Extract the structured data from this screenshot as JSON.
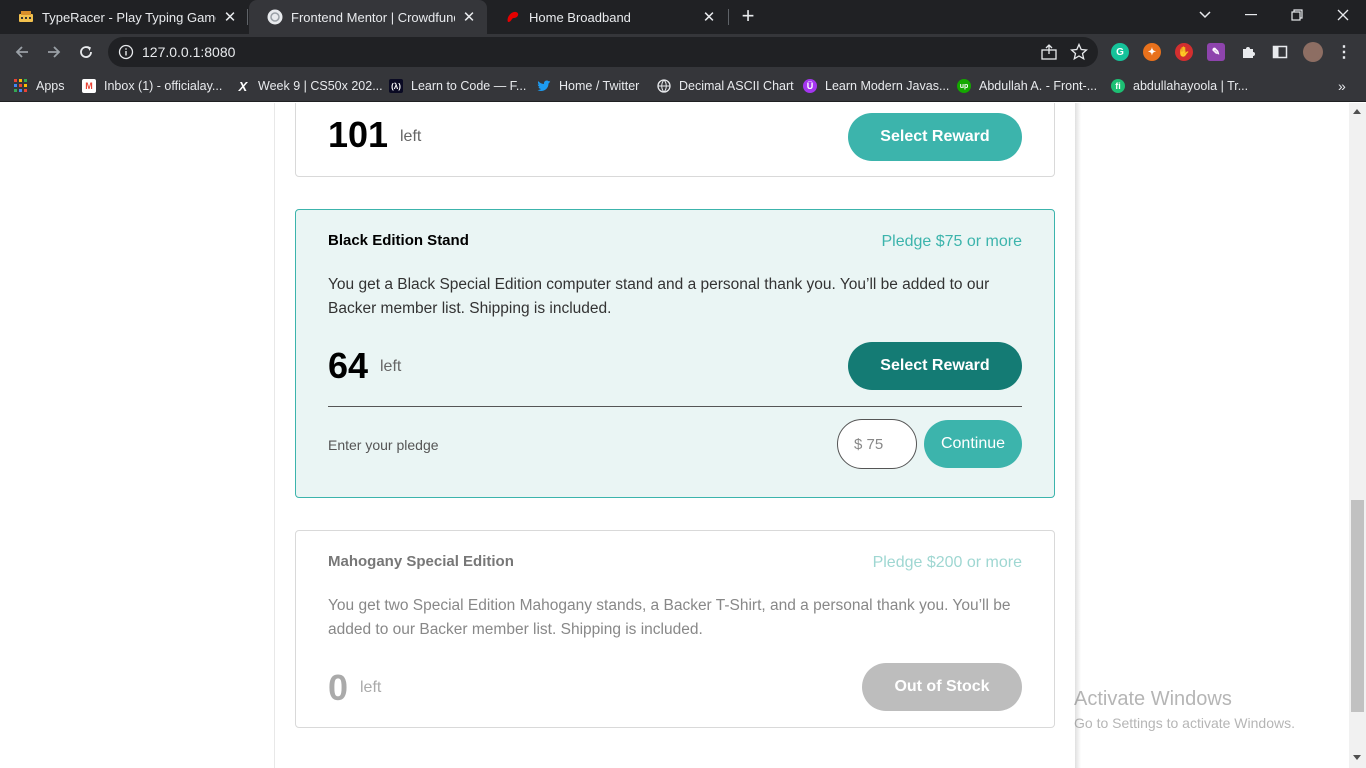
{
  "browser": {
    "tabs": [
      {
        "title": "TypeRacer - Play Typing Games a",
        "icon": "typeracer-icon"
      },
      {
        "title": "Frontend Mentor | Crowdfunding",
        "icon": "frontend-mentor-icon"
      },
      {
        "title": "Home Broadband",
        "icon": "airtel-icon"
      }
    ],
    "new_tab": "+",
    "url": "127.0.0.1:8080",
    "bookmarks": [
      {
        "label": "Apps",
        "icon": "apps-grid-icon"
      },
      {
        "label": "Inbox (1) - officialay...",
        "icon": "gmail-icon"
      },
      {
        "label": "Week 9 | CS50x 202...",
        "icon": "cs50-icon"
      },
      {
        "label": "Learn to Code — F...",
        "icon": "freecodecamp-icon"
      },
      {
        "label": "Home / Twitter",
        "icon": "twitter-icon"
      },
      {
        "label": "Decimal ASCII Chart",
        "icon": "globe-icon"
      },
      {
        "label": "Learn Modern Javas...",
        "icon": "udemy-icon"
      },
      {
        "label": "Abdullah A. - Front-...",
        "icon": "upwork-icon"
      },
      {
        "label": "abdullahayoola | Tr...",
        "icon": "fiverr-icon"
      }
    ],
    "bookmarks_more": "»"
  },
  "rewards": [
    {
      "left_count": "101",
      "left_label": "left",
      "button": "Select Reward"
    },
    {
      "title": "Black Edition Stand",
      "pledge": "Pledge $75 or more",
      "description": "You get a Black Special Edition computer stand and a personal thank you. You’ll be added to our Backer member list. Shipping is included.",
      "left_count": "64",
      "left_label": "left",
      "button": "Select Reward",
      "enter_pledge_label": "Enter your pledge",
      "pledge_input_value": "$ 75",
      "continue_button": "Continue"
    },
    {
      "title": "Mahogany Special Edition",
      "pledge": "Pledge $200 or more",
      "description": "You get two Special Edition Mahogany stands, a Backer T-Shirt, and a personal thank you. You’ll be added to our Backer member list. Shipping is included.",
      "left_count": "0",
      "left_label": "left",
      "button": "Out of Stock"
    }
  ],
  "watermark": {
    "line1": "Activate Windows",
    "line2": "Go to Settings to activate Windows."
  },
  "colors": {
    "accent": "#3cb4ac",
    "accent_dark": "#147b74",
    "disabled": "#bdbdbd",
    "selected_bg": "#eaf5f4"
  }
}
